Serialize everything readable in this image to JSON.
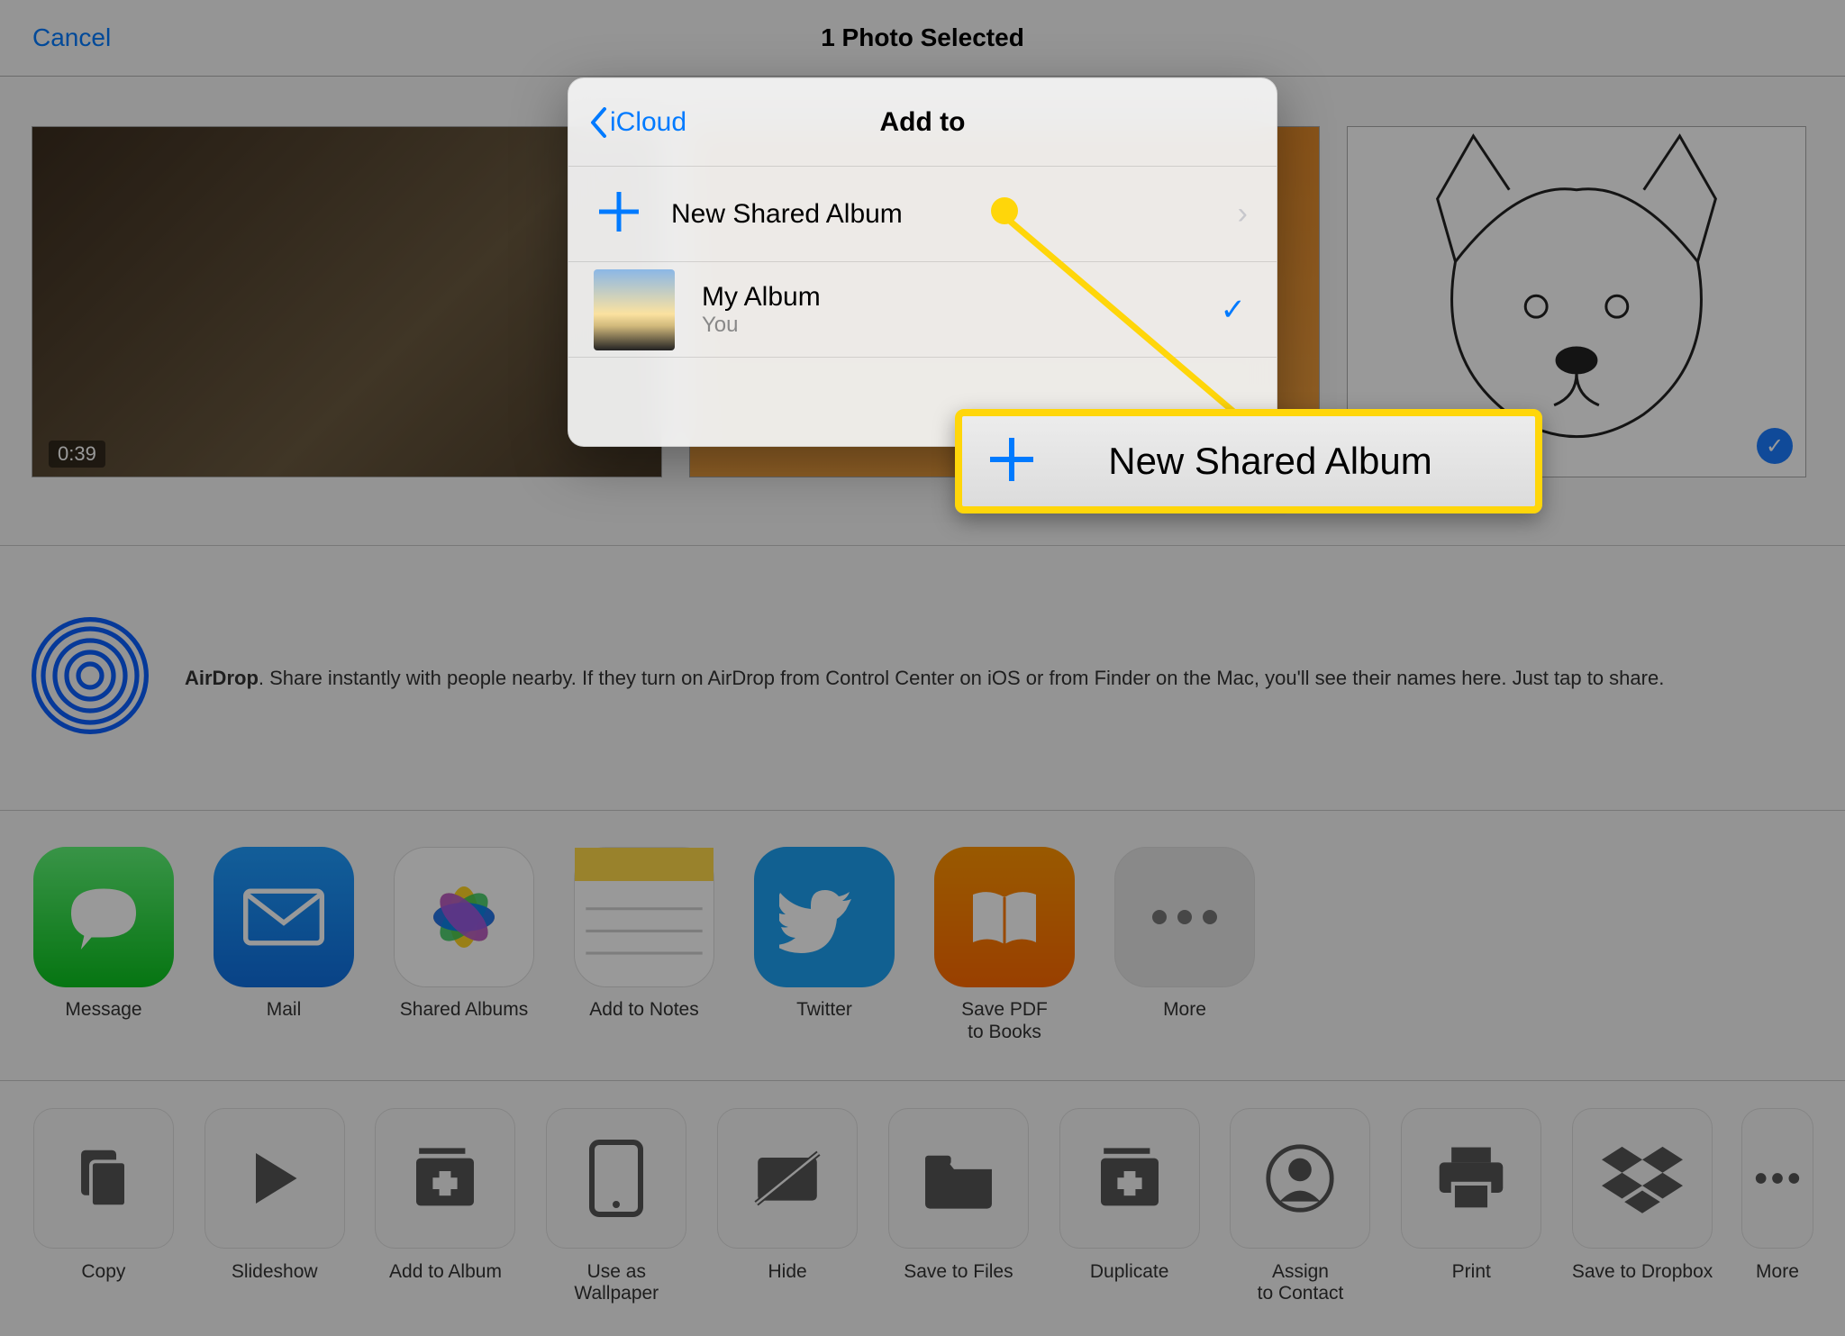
{
  "header": {
    "cancel": "Cancel",
    "title": "1 Photo Selected"
  },
  "thumbs": {
    "duration": "0:39"
  },
  "popover": {
    "back": "iCloud",
    "title": "Add to",
    "new_shared": "New Shared Album",
    "my_album": {
      "title": "My Album",
      "subtitle": "You"
    }
  },
  "callout": {
    "label": "New Shared Album"
  },
  "airdrop": {
    "label": "AirDrop",
    "text": ". Share instantly with people nearby. If they turn on AirDrop from Control Center on iOS or from Finder on the Mac, you'll see their names here. Just tap to share."
  },
  "share": [
    {
      "label": "Message"
    },
    {
      "label": "Mail"
    },
    {
      "label": "Shared Albums"
    },
    {
      "label": "Add to Notes"
    },
    {
      "label": "Twitter"
    },
    {
      "label": "Save PDF\nto Books"
    },
    {
      "label": "More"
    }
  ],
  "actions": [
    {
      "label": "Copy"
    },
    {
      "label": "Slideshow"
    },
    {
      "label": "Add to Album"
    },
    {
      "label": "Use as\nWallpaper"
    },
    {
      "label": "Hide"
    },
    {
      "label": "Save to Files"
    },
    {
      "label": "Duplicate"
    },
    {
      "label": "Assign\nto Contact"
    },
    {
      "label": "Print"
    },
    {
      "label": "Save to Dropbox"
    },
    {
      "label": "More"
    }
  ]
}
